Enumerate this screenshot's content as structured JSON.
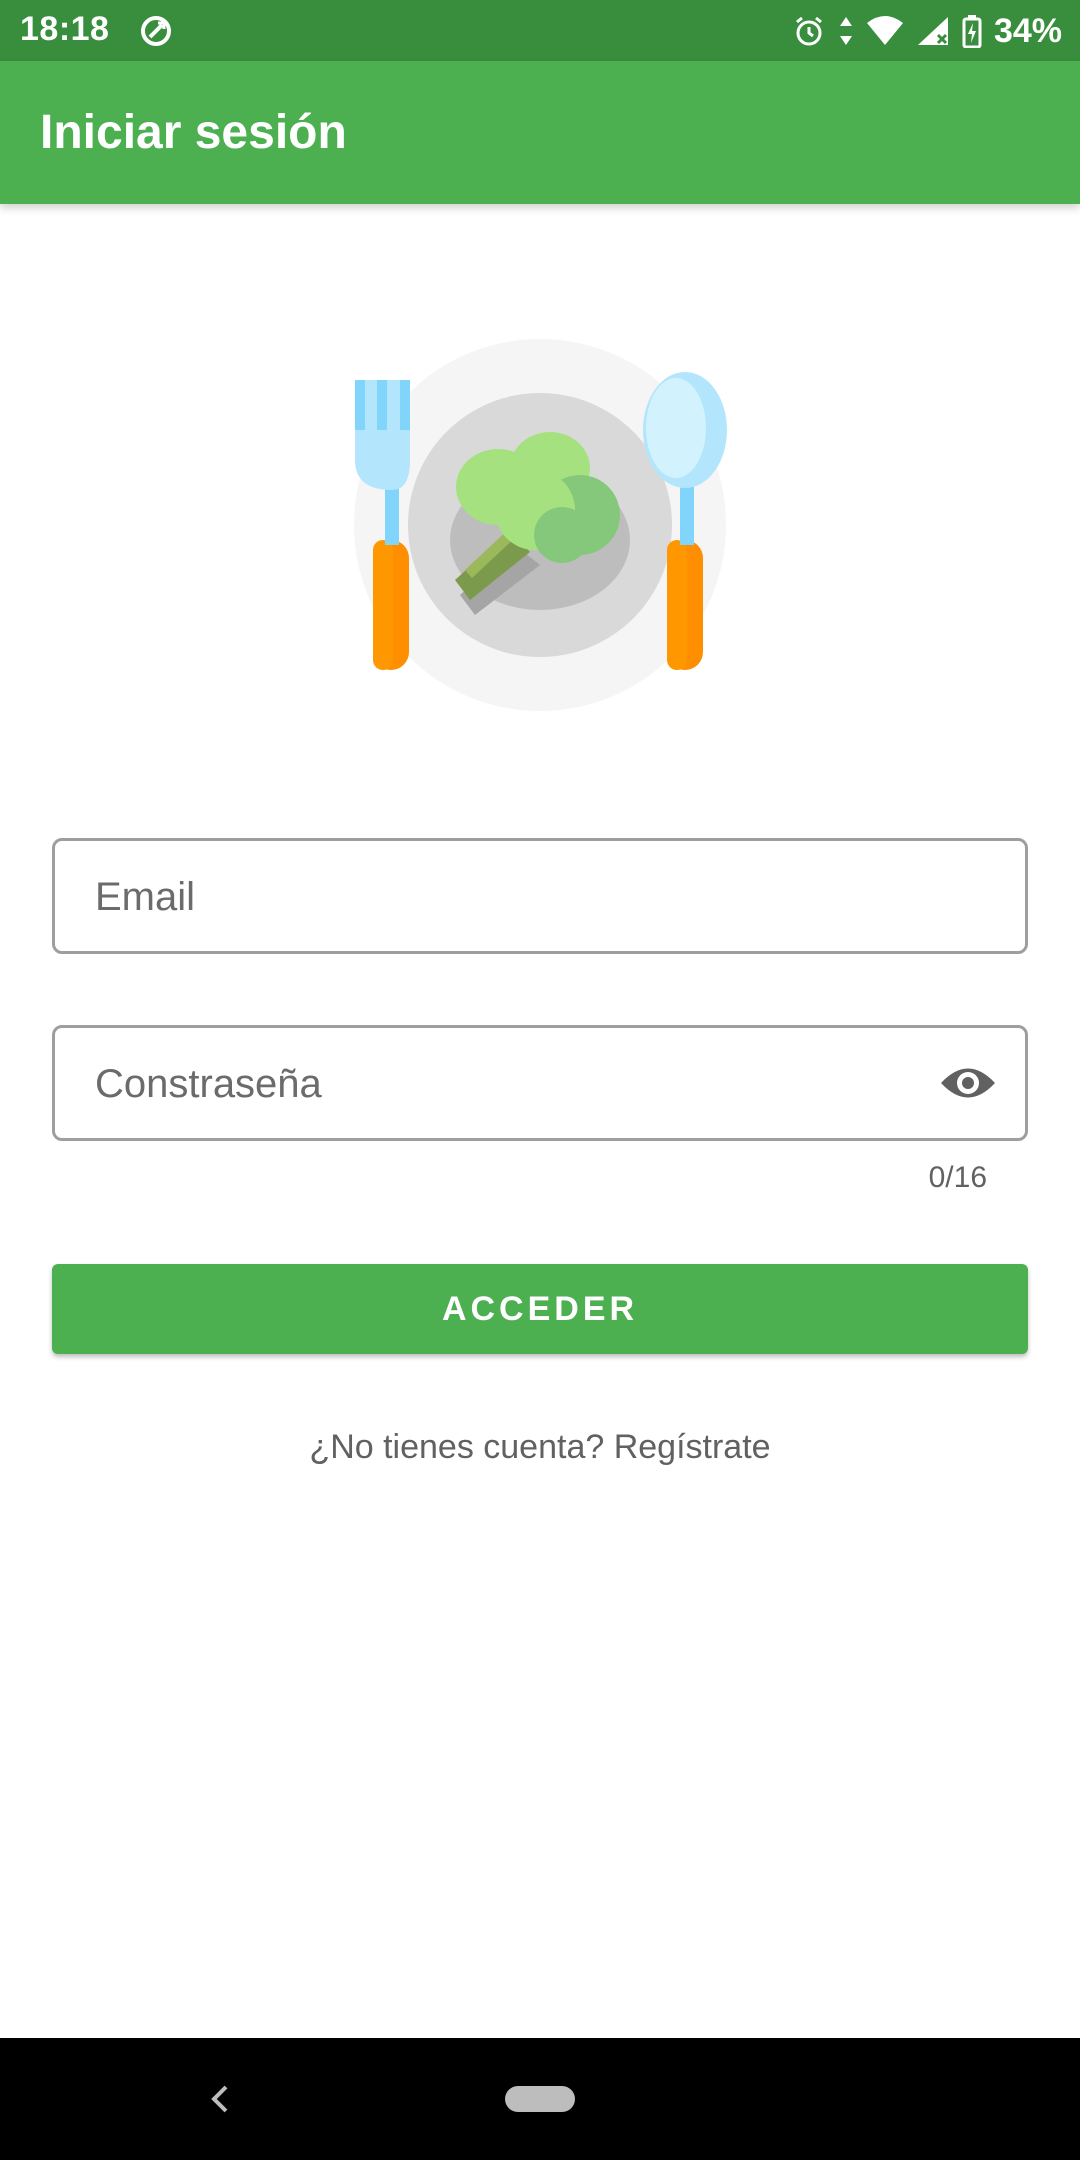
{
  "status_bar": {
    "time": "18:18",
    "battery": "34%",
    "icons": [
      "sync-icon",
      "alarm-icon",
      "data-arrows-icon",
      "wifi-icon",
      "signal-icon",
      "battery-charging-icon"
    ]
  },
  "app_bar": {
    "title": "Iniciar sesión"
  },
  "logo": {
    "icon": "plate-broccoli-cutlery-icon"
  },
  "form": {
    "email_placeholder": "Email",
    "password_placeholder": "Constraseña",
    "password_counter": "0/16",
    "submit_label": "ACCEDER",
    "register_text": "¿No tienes cuenta? Regístrate"
  },
  "nav_bar": {
    "icons": [
      "back-icon",
      "home-pill-icon"
    ]
  },
  "colors": {
    "primary": "#4caf50",
    "primary_dark": "#388e3c",
    "text_secondary": "#616161"
  }
}
